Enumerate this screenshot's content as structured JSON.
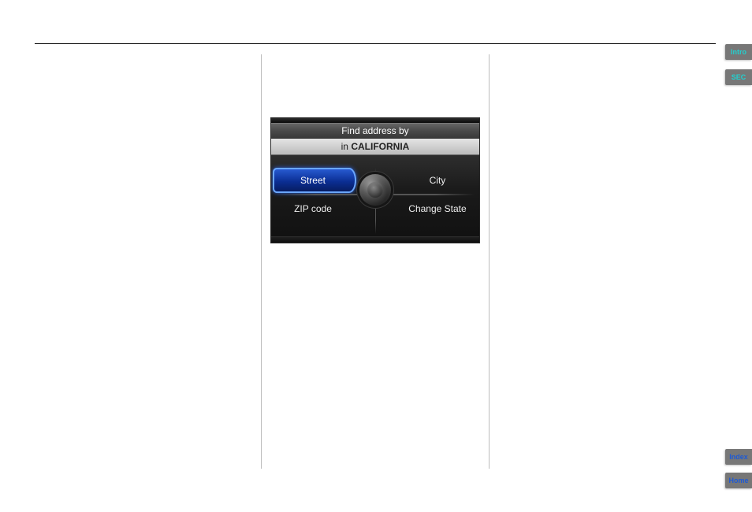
{
  "nav": {
    "title": "Find address by",
    "subtitle_prefix": "in ",
    "subtitle_state": "CALIFORNIA",
    "options": {
      "top_left": "Street",
      "top_right": "City",
      "bottom_left": "ZIP code",
      "bottom_right": "Change State"
    }
  },
  "tabs": {
    "intro": "Intro",
    "sec": "SEC",
    "index": "Index",
    "home": "Home"
  }
}
